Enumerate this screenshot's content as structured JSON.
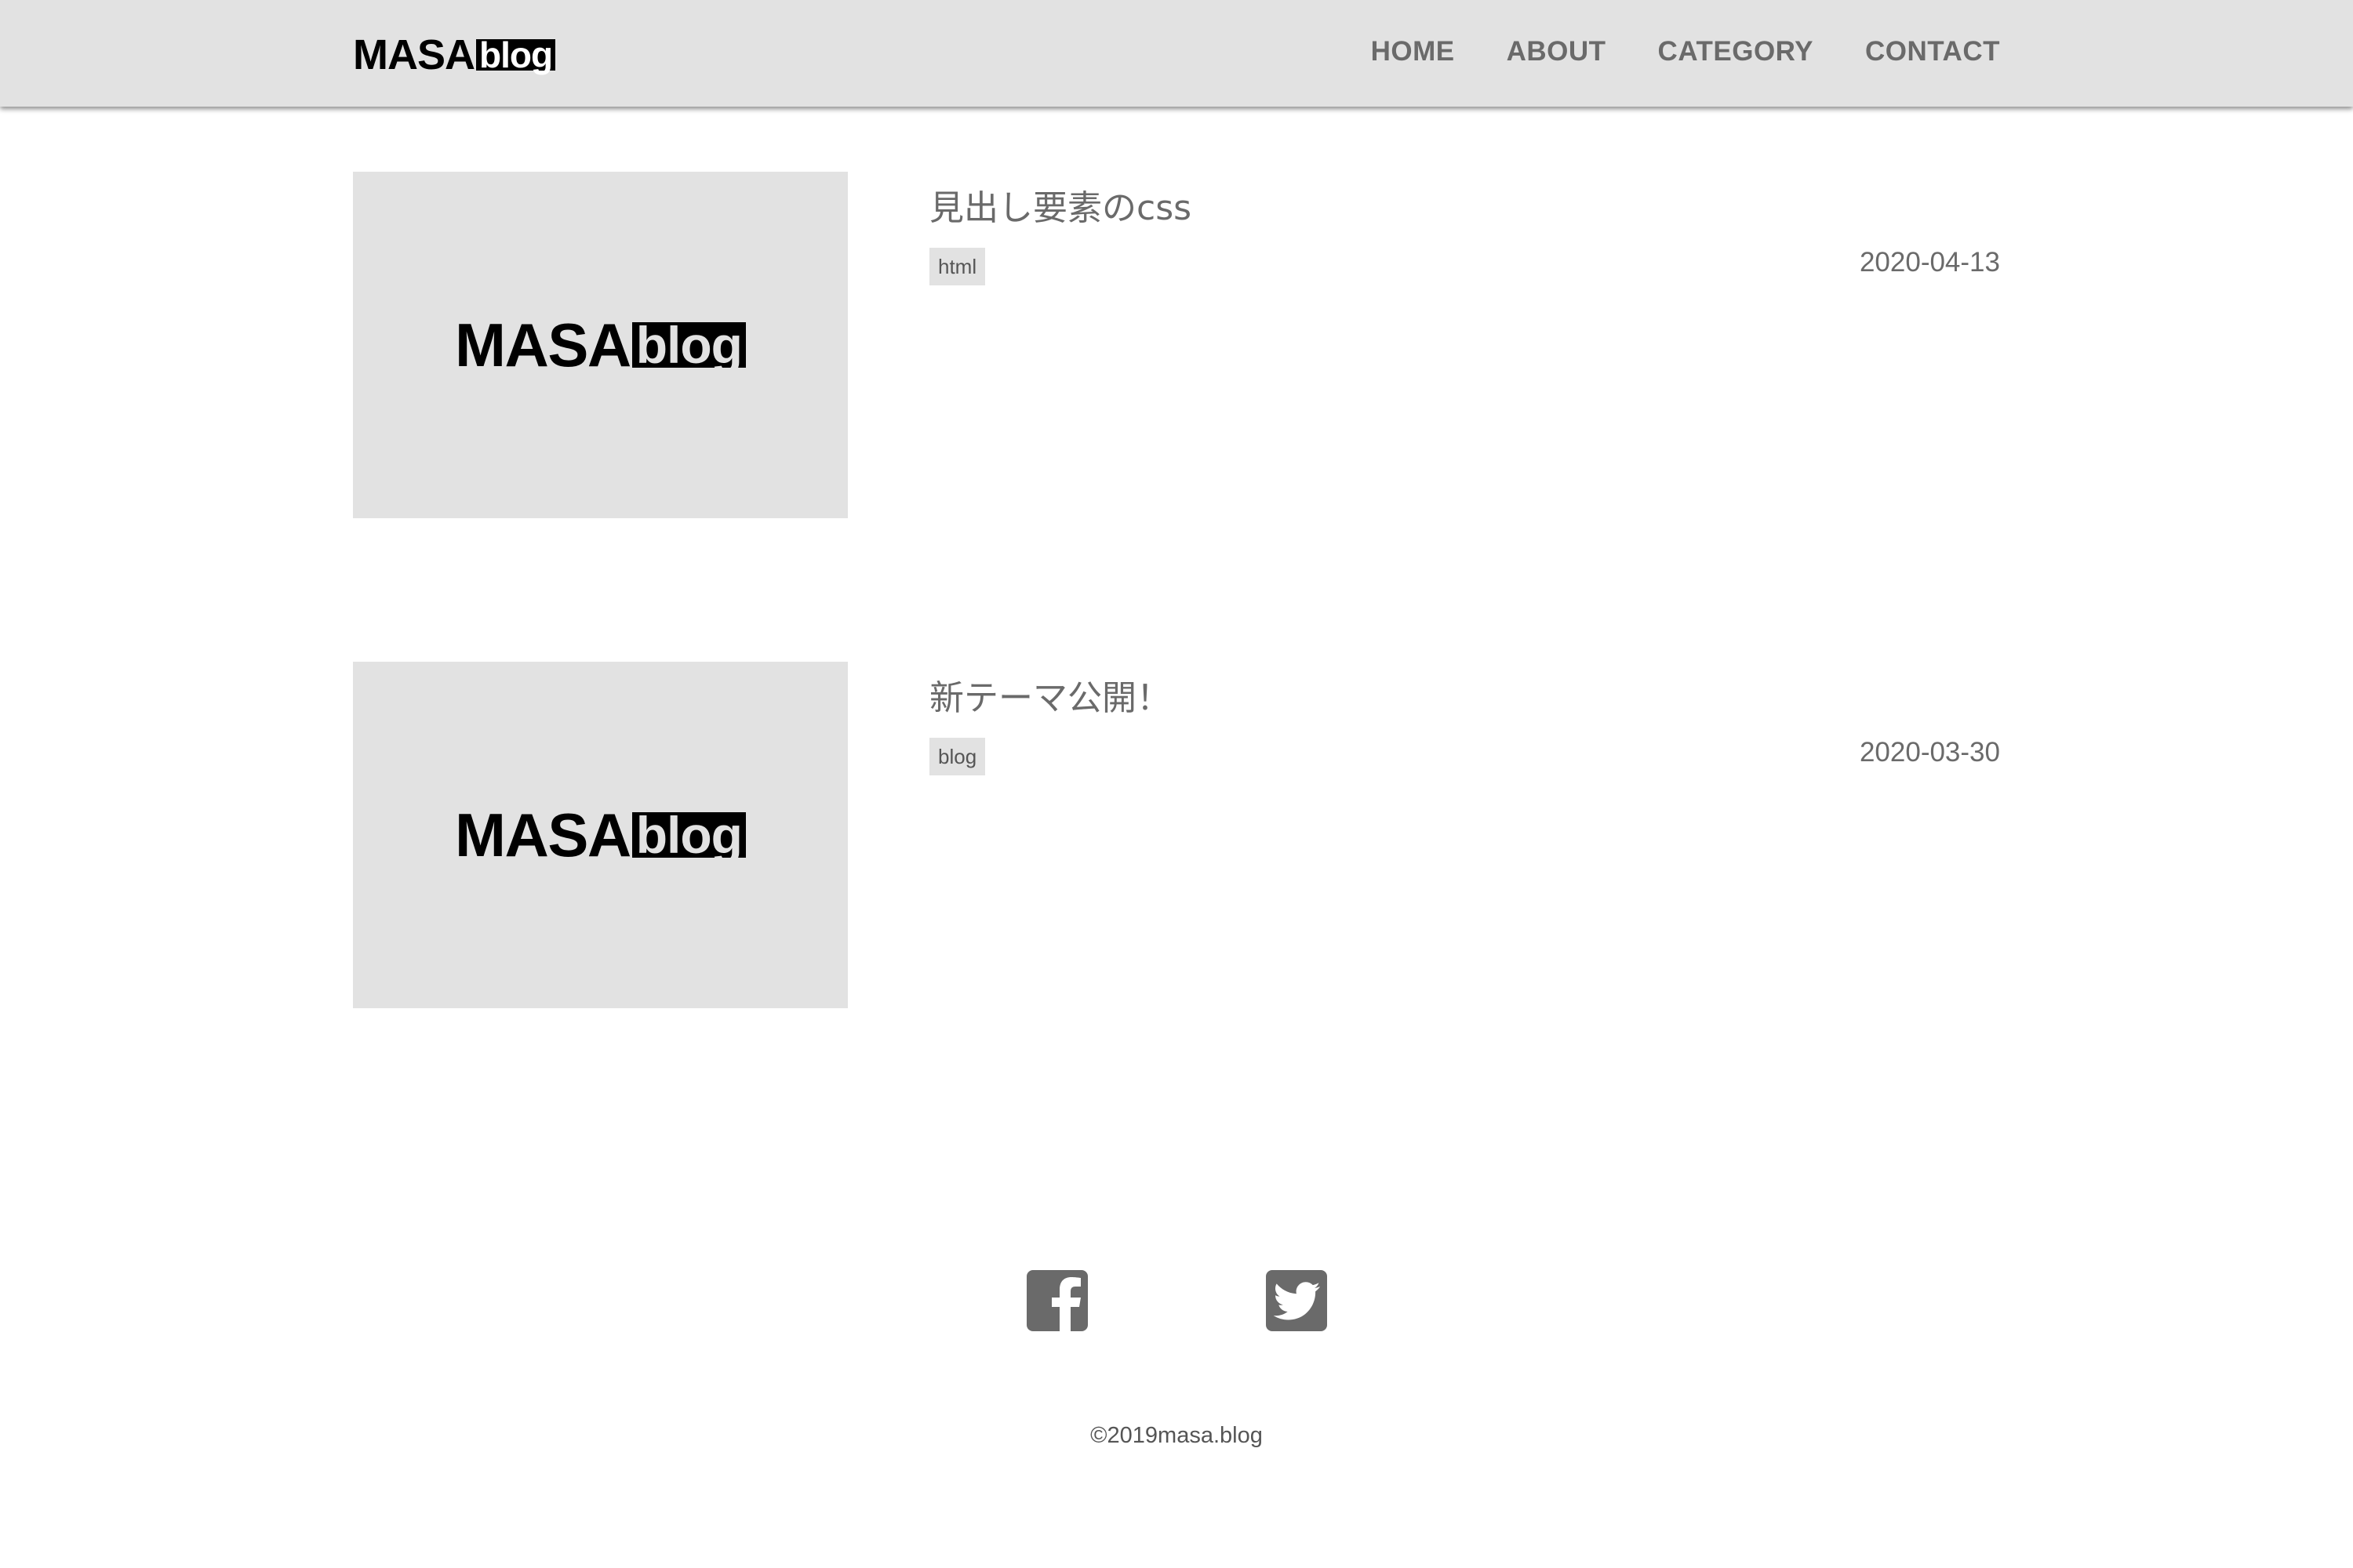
{
  "header": {
    "logo_masa": "MASA",
    "logo_blog": "blog",
    "nav": [
      "HOME",
      "ABOUT",
      "CATEGORY",
      "CONTACT"
    ]
  },
  "articles": [
    {
      "title": "見出し要素のcss",
      "tag": "html",
      "date": "2020-04-13",
      "thumb_logo_masa": "MASA",
      "thumb_logo_blog": "blog"
    },
    {
      "title": "新テーマ公開！",
      "tag": "blog",
      "date": "2020-03-30",
      "thumb_logo_masa": "MASA",
      "thumb_logo_blog": "blog"
    }
  ],
  "footer": {
    "social": [
      "facebook-icon",
      "twitter-icon"
    ],
    "copyright": "©2019masa.blog"
  },
  "colors": {
    "header_bg": "#e2e2e2",
    "text_gray": "#6a6a6a",
    "tag_bg": "#e2e2e2"
  }
}
